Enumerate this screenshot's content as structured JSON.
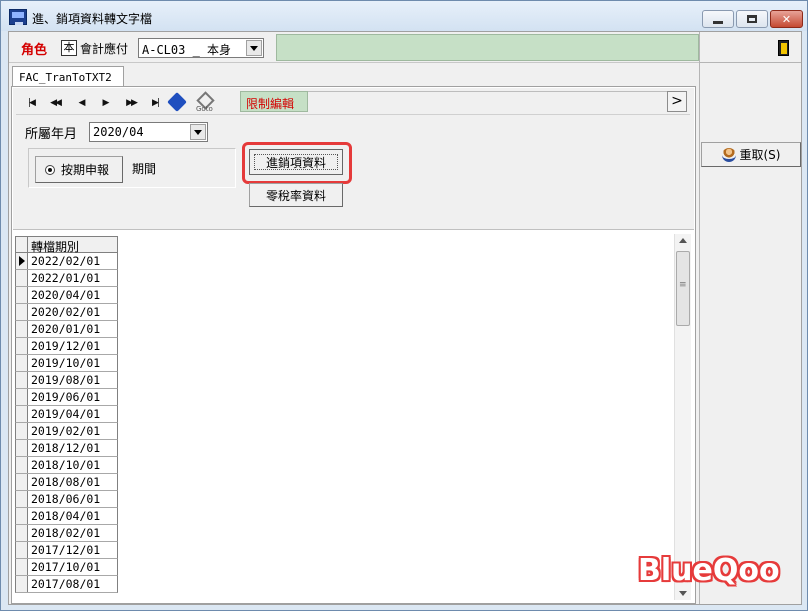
{
  "window": {
    "title": "進、銷項資料轉文字檔"
  },
  "rolebar": {
    "label": "角色",
    "badge": "本",
    "unit": "會計應付",
    "selected": "A-CL03 _ 本身"
  },
  "right_panel": {
    "reset_label": "重取(S)"
  },
  "tab": {
    "label": "FAC_TranToTXT2"
  },
  "nav": {
    "first": "|◀",
    "prev_page": "◀◀",
    "prev": "◀",
    "next": "▶",
    "next_page": "▶▶",
    "last": "▶|",
    "goto_label": "Goto",
    "restricted_edit": "限制編輯",
    "more": ">"
  },
  "form": {
    "period_label": "所屬年月",
    "period_value": "2020/04",
    "radio_label": "按期申報",
    "period_text": "期間",
    "btn_sales": "進銷項資料",
    "btn_zero": "零稅率資料"
  },
  "grid": {
    "column": "轉檔期別",
    "rows": [
      "2022/02/01",
      "2022/01/01",
      "2020/04/01",
      "2020/02/01",
      "2020/01/01",
      "2019/12/01",
      "2019/10/01",
      "2019/08/01",
      "2019/06/01",
      "2019/04/01",
      "2019/02/01",
      "2018/12/01",
      "2018/10/01",
      "2018/08/01",
      "2018/06/01",
      "2018/04/01",
      "2018/02/01",
      "2017/12/01",
      "2017/10/01",
      "2017/08/01"
    ]
  },
  "watermark": "BlueQoo"
}
